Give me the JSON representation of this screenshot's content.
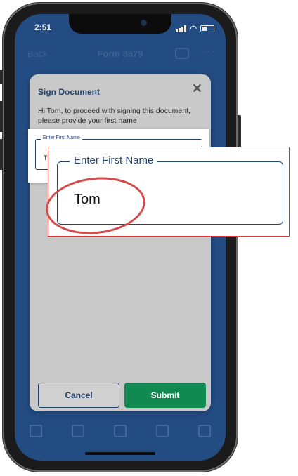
{
  "status_bar": {
    "time": "2:51"
  },
  "nav": {
    "back_label": "Back",
    "title": "Form 8879",
    "more_label": "···"
  },
  "dialog": {
    "title": "Sign Document",
    "close_label": "✕",
    "message": "Hi Tom, to proceed with signing this document, please provide your first name",
    "field_label": "Enter First Name",
    "field_value": "Tom",
    "field_value_truncated": "T",
    "cancel_label": "Cancel",
    "submit_label": "Submit"
  },
  "colors": {
    "app_blue": "#26538f",
    "dialog_bg": "#c9c9c9",
    "submit_green": "#118a52",
    "accent_dark_blue": "#23446f",
    "highlight_red": "#d64a4a"
  },
  "tab_icons": [
    "home-icon",
    "document-icon",
    "message-icon",
    "sign-icon",
    "forms-icon"
  ]
}
